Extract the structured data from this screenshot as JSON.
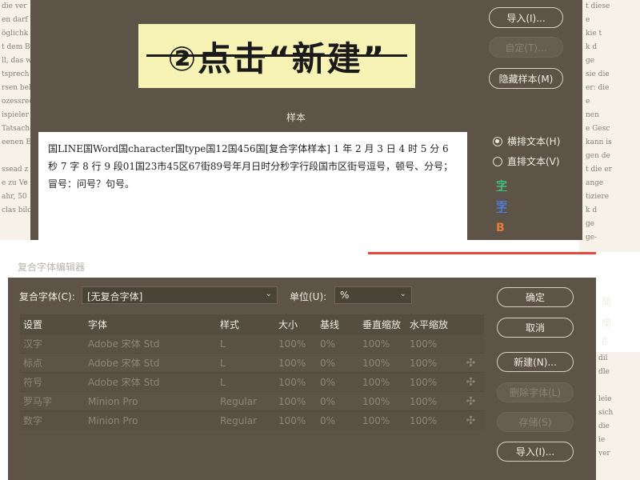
{
  "background_doc": {
    "left_lines": [
      "die ver",
      "en darf",
      "öglichk",
      "t dem B",
      "ll, das w",
      "tsprech",
      "rsen beha",
      "ozessrec",
      "ispieler",
      "Tatsache",
      "eenen E",
      "",
      "ssead z",
      "e zu Ve",
      "ahr, 50",
      "clas bild"
    ],
    "right_lines": [
      "t diese",
      "e",
      "kie t",
      "k d",
      "ge",
      "sie die",
      "er: die",
      "e",
      "nen",
      "e Gesc",
      "kann is",
      "gen de",
      "t die er",
      "ange",
      "tiziere",
      "k d",
      "ge",
      "ge-"
    ],
    "right_low_lines": [
      "dil",
      "dle",
      "",
      "leie",
      "sich",
      "die",
      "ie",
      "ver"
    ]
  },
  "upper_dialog": {
    "banner_text": "②点击“新建”",
    "sample_label": "样本",
    "sample_text": "国LINE国Word国character国type国12国456国[复合字体样本] 1 年 2 月 3 日 4 时 5 分 6 秒 7 字 8 行 9 段01国23市45区67街89号年月日时分秒字行段国市区街号逗号，顿号、分号；冒号：问号？句号。",
    "buttons": {
      "import": "导入(I)...",
      "custom": "自定(T)...",
      "hide_sample": "隐藏样本(M)"
    },
    "radio": {
      "horizontal": "横排文本(H)",
      "vertical": "直排文本(V)"
    },
    "icons": [
      "green-char-icon",
      "blue-char-icon",
      "orange-b-icon"
    ]
  },
  "lower_dialog": {
    "title": "复合字体编辑器",
    "composite_font_label": "复合字体(C):",
    "composite_font_value": "[无复合字体]",
    "unit_label": "单位(U):",
    "unit_value": "%",
    "columns": [
      "设置",
      "字体",
      "样式",
      "大小",
      "基线",
      "垂直缩放",
      "水平缩放"
    ],
    "rows": [
      {
        "setting": "汉字",
        "font": "Adobe 宋体 Std",
        "style": "L",
        "size": "100%",
        "baseline": "0%",
        "vscale": "100%",
        "hscale": "100%",
        "move": false
      },
      {
        "setting": "标点",
        "font": "Adobe 宋体 Std",
        "style": "L",
        "size": "100%",
        "baseline": "0%",
        "vscale": "100%",
        "hscale": "100%",
        "move": true
      },
      {
        "setting": "符号",
        "font": "Adobe 宋体 Std",
        "style": "L",
        "size": "100%",
        "baseline": "0%",
        "vscale": "100%",
        "hscale": "100%",
        "move": true
      },
      {
        "setting": "罗马字",
        "font": "Minion Pro",
        "style": "Regular",
        "size": "100%",
        "baseline": "0%",
        "vscale": "100%",
        "hscale": "100%",
        "move": true
      },
      {
        "setting": "数字",
        "font": "Minion Pro",
        "style": "Regular",
        "size": "100%",
        "baseline": "0%",
        "vscale": "100%",
        "hscale": "100%",
        "move": true
      }
    ],
    "buttons": {
      "ok": "确定",
      "cancel": "取消",
      "new": "新建(N)...",
      "delete_font": "删除字体(L)",
      "save": "存储(S)",
      "import": "导入(I)..."
    },
    "side_fragments": [
      "簡",
      "簡",
      "ß"
    ]
  }
}
